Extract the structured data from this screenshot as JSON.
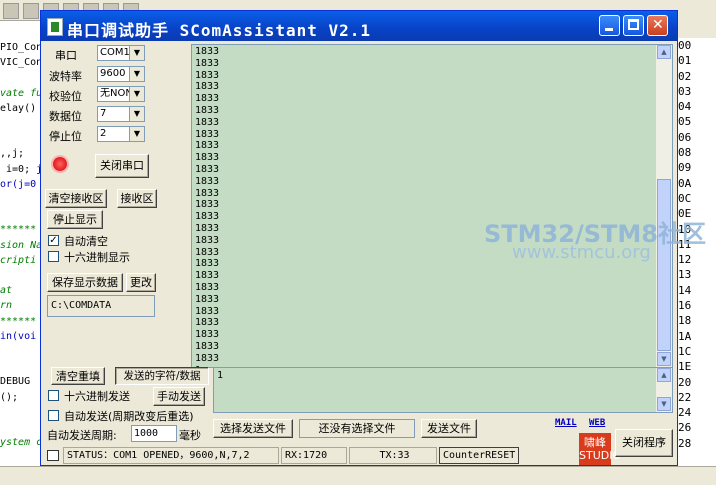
{
  "window": {
    "title": "串口调试助手 SComAssistant V2.1",
    "minimize": "_",
    "maximize": "□",
    "close": "✕"
  },
  "settings": {
    "port_label": "串口",
    "port_value": "COM1",
    "baud_label": "波特率",
    "baud_value": "9600",
    "parity_label": "校验位",
    "parity_value": "无NONE",
    "databits_label": "数据位",
    "databits_value": "7",
    "stopbits_label": "停止位",
    "stopbits_value": "2"
  },
  "buttons": {
    "close_port": "关闭串口",
    "clear_recv": "清空接收区",
    "recv_area": "接收区",
    "stop_display": "停止显示",
    "save_display": "保存显示数据",
    "change": "更改",
    "clear_resend": "清空重填",
    "send_chars": "发送的字符/数据",
    "manual_send": "手动发送",
    "select_send_file": "选择发送文件",
    "send_file": "发送文件",
    "close_program": "关闭程序"
  },
  "checks": {
    "auto_clear": "自动清空",
    "auto_clear_checked": true,
    "hex_display": "十六进制显示",
    "hex_display_checked": false,
    "hex_send": "十六进制发送",
    "hex_send_checked": false,
    "auto_send": "自动发送(周期改变后重选)",
    "auto_send_checked": false
  },
  "save_path": "C:\\COMDATA",
  "receive_text": "1833\n1833\n1833\n1833\n1833\n1833\n1833\n1833\n1833\n1833\n1833\n1833\n1833\n1833\n1833\n1833\n1833\n1833\n1833\n1833\n1833\n1833\n1833\n1833\n1833\n1833\n1833\n1\n",
  "send_text": "1",
  "period_label": "自动发送周期:",
  "period_value": "1000",
  "period_unit": "毫秒",
  "no_file_text": "还没有选择文件",
  "links": {
    "mail": "MAIL",
    "web": "WEB"
  },
  "logo_text": "啸峰\nSTUDIO",
  "status": {
    "main": "STATUS：COM1 OPENED，9600,N,7,2",
    "rx": "RX:1720",
    "tx": "TX:33",
    "reset": "CounterRESET"
  },
  "watermark": {
    "line1": "STM32/STM8社区",
    "line2": "www.stmcu.org"
  },
  "background": {
    "code_lines": [
      "PIO_Con",
      "VIC_Con",
      "",
      "vate fu",
      "elay()",
      "",
      "",
      ",,j;",
      " i=0; j",
      "or(j=0",
      "",
      "",
      "******",
      "sion Na",
      "cripti",
      "",
      "at",
      "rn",
      "******",
      "in(voi",
      "",
      "",
      "DEBUG",
      "();",
      "",
      "",
      "ystem c"
    ],
    "right_values": [
      "00",
      "01",
      "02",
      "03",
      "04",
      "05",
      "06",
      "08",
      "09",
      "0A",
      "0C",
      "0E",
      "10",
      "11",
      "12",
      "13",
      "14",
      "16",
      "18",
      "1A",
      "1C",
      "1E",
      "20",
      "22",
      "24",
      "26",
      "28"
    ]
  }
}
